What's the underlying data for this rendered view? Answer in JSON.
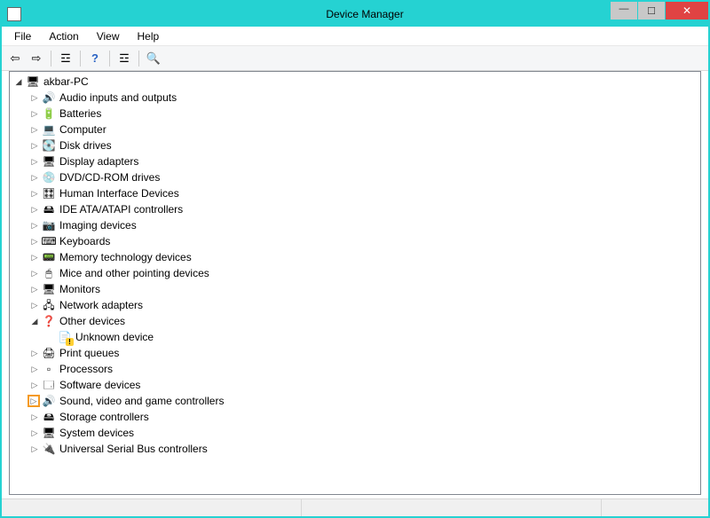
{
  "window": {
    "title": "Device Manager"
  },
  "menu": {
    "file": "File",
    "action": "Action",
    "view": "View",
    "help": "Help"
  },
  "tree": {
    "root": {
      "label": "akbar-PC",
      "expanded": true,
      "icon": "computer-icon",
      "children": [
        {
          "label": "Audio inputs and outputs",
          "icon": "speaker-icon"
        },
        {
          "label": "Batteries",
          "icon": "battery-icon"
        },
        {
          "label": "Computer",
          "icon": "pc-icon"
        },
        {
          "label": "Disk drives",
          "icon": "disk-icon"
        },
        {
          "label": "Display adapters",
          "icon": "display-icon"
        },
        {
          "label": "DVD/CD-ROM drives",
          "icon": "cd-icon"
        },
        {
          "label": "Human Interface Devices",
          "icon": "hid-icon"
        },
        {
          "label": "IDE ATA/ATAPI controllers",
          "icon": "ide-icon"
        },
        {
          "label": "Imaging devices",
          "icon": "camera-icon"
        },
        {
          "label": "Keyboards",
          "icon": "keyboard-icon"
        },
        {
          "label": "Memory technology devices",
          "icon": "memory-icon"
        },
        {
          "label": "Mice and other pointing devices",
          "icon": "mouse-icon"
        },
        {
          "label": "Monitors",
          "icon": "monitor-icon"
        },
        {
          "label": "Network adapters",
          "icon": "network-icon"
        },
        {
          "label": "Other devices",
          "icon": "other-icon",
          "expanded": true,
          "children": [
            {
              "label": "Unknown device",
              "icon": "unknown-icon",
              "leaf": true,
              "warn": true
            }
          ]
        },
        {
          "label": "Print queues",
          "icon": "printer-icon"
        },
        {
          "label": "Processors",
          "icon": "cpu-icon"
        },
        {
          "label": "Software devices",
          "icon": "software-icon"
        },
        {
          "label": "Sound, video and game controllers",
          "icon": "speaker-icon",
          "highlight": true
        },
        {
          "label": "Storage controllers",
          "icon": "storage-icon"
        },
        {
          "label": "System devices",
          "icon": "system-icon"
        },
        {
          "label": "Universal Serial Bus controllers",
          "icon": "usb-icon"
        }
      ]
    }
  },
  "icons": {
    "computer-icon": "🖥",
    "speaker-icon": "🔊",
    "battery-icon": "🔋",
    "pc-icon": "💻",
    "disk-icon": "💽",
    "display-icon": "🖥",
    "cd-icon": "💿",
    "hid-icon": "🎛",
    "ide-icon": "🖴",
    "camera-icon": "📷",
    "keyboard-icon": "⌨",
    "memory-icon": "📟",
    "mouse-icon": "🖱",
    "monitor-icon": "🖥",
    "network-icon": "🖧",
    "other-icon": "❓",
    "unknown-icon": "📄",
    "printer-icon": "🖨",
    "cpu-icon": "▫",
    "software-icon": "🗔",
    "storage-icon": "🖴",
    "system-icon": "🖥",
    "usb-icon": "🔌"
  }
}
